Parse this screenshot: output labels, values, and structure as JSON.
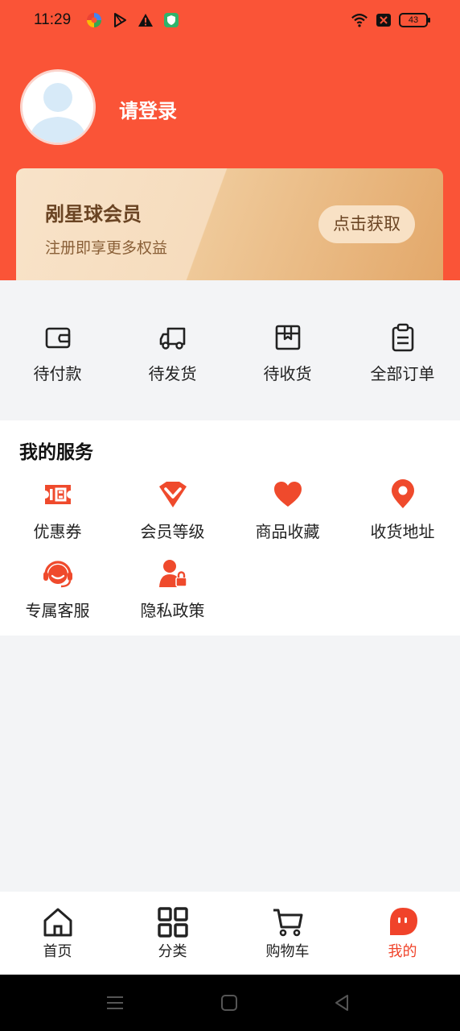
{
  "status_bar": {
    "time": "11:29",
    "battery": "43"
  },
  "profile": {
    "login_text": "请登录"
  },
  "vip_card": {
    "title": "剐星球会员",
    "subtitle": "注册即享更多权益",
    "button_label": "点击获取"
  },
  "orders": [
    {
      "label": "待付款",
      "icon": "wallet-icon"
    },
    {
      "label": "待发货",
      "icon": "truck-icon"
    },
    {
      "label": "待收货",
      "icon": "package-icon"
    },
    {
      "label": "全部订单",
      "icon": "clipboard-icon"
    }
  ],
  "services": {
    "title": "我的服务",
    "items": [
      {
        "label": "优惠券",
        "icon": "coupon-icon"
      },
      {
        "label": "会员等级",
        "icon": "vip-level-icon"
      },
      {
        "label": "商品收藏",
        "icon": "heart-icon"
      },
      {
        "label": "收货地址",
        "icon": "location-pin-icon"
      },
      {
        "label": "专属客服",
        "icon": "headset-icon"
      },
      {
        "label": "隐私政策",
        "icon": "user-lock-icon"
      }
    ]
  },
  "tabbar": [
    {
      "label": "首页",
      "icon": "home-icon",
      "active": false
    },
    {
      "label": "分类",
      "icon": "grid-icon",
      "active": false
    },
    {
      "label": "购物车",
      "icon": "cart-icon",
      "active": false
    },
    {
      "label": "我的",
      "icon": "profile-icon",
      "active": true
    }
  ],
  "colors": {
    "primary": "#fa5437",
    "accent_red": "#f0432a",
    "vip_gold": "#e3a86a",
    "background": "#f3f4f6"
  }
}
